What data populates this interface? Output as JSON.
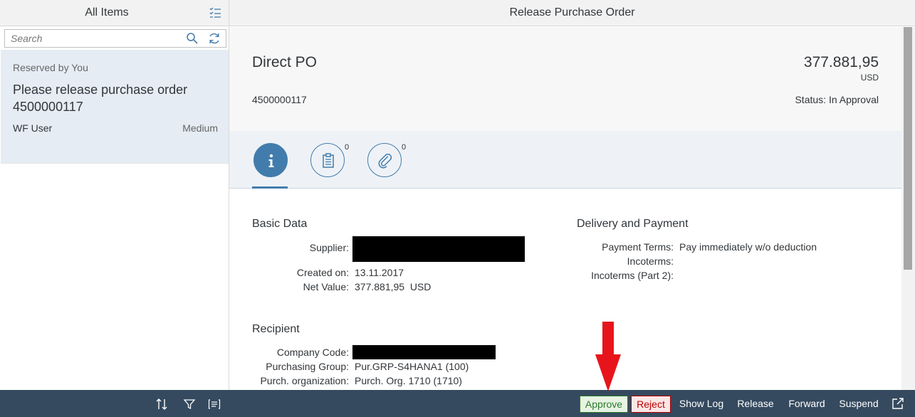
{
  "master": {
    "title": "All Items",
    "search": {
      "placeholder": "Search",
      "value": ""
    },
    "item": {
      "status": "Reserved by You",
      "title": "Please release purchase order 4500000117",
      "user": "WF User",
      "priority": "Medium"
    }
  },
  "detail": {
    "header_title": "Release Purchase Order",
    "object": {
      "title": "Direct PO",
      "number": "4500000117",
      "amount": "377.881,95",
      "currency": "USD",
      "status": "Status: In Approval"
    },
    "tabs": [
      {
        "icon": "info-icon",
        "count": ""
      },
      {
        "icon": "notes-icon",
        "count": "0"
      },
      {
        "icon": "attachment-icon",
        "count": "0"
      }
    ],
    "basic_data": {
      "title": "Basic Data",
      "supplier_label": "Supplier:",
      "created_label": "Created on:",
      "created_value": "13.11.2017",
      "net_label": "Net Value:",
      "net_value": "377.881,95  USD"
    },
    "delivery": {
      "title": "Delivery and Payment",
      "terms_label": "Payment Terms:",
      "terms_value": "Pay immediately w/o deduction",
      "incoterms_label": "Incoterms:",
      "incoterms2_label": "Incoterms (Part 2):"
    },
    "recipient": {
      "title": "Recipient",
      "company_label": "Company Code:",
      "group_label": "Purchasing Group:",
      "group_value": "Pur.GRP-S4HANA1 (100)",
      "org_label": "Purch. organization:",
      "org_value": "Purch. Org. 1710 (1710)"
    },
    "footer": {
      "approve": "Approve",
      "reject": "Reject",
      "show_log": "Show Log",
      "release": "Release",
      "forward": "Forward",
      "suspend": "Suspend"
    }
  },
  "colors": {
    "shell": "#354a5f",
    "accent": "#427cac",
    "approve": "#2b7c2b",
    "reject": "#bb0000",
    "arrow": "#e8141b"
  }
}
